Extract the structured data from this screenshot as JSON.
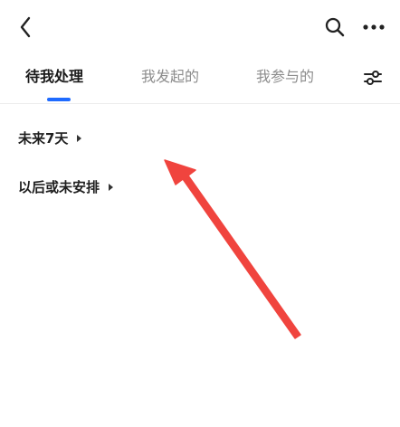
{
  "header": {
    "back_icon": "chevron-left-icon",
    "search_icon": "search-icon",
    "more_icon": "more-horizontal-icon"
  },
  "tabs": [
    {
      "label": "待我处理",
      "active": true
    },
    {
      "label": "我发起的",
      "active": false
    },
    {
      "label": "我参与的",
      "active": false
    }
  ],
  "filter_icon": "sliders-icon",
  "colors": {
    "accent": "#1f6bff",
    "annotation_arrow": "#f0443e"
  },
  "sections": [
    {
      "label": "未来7天"
    },
    {
      "label": "以后或未安排"
    }
  ]
}
